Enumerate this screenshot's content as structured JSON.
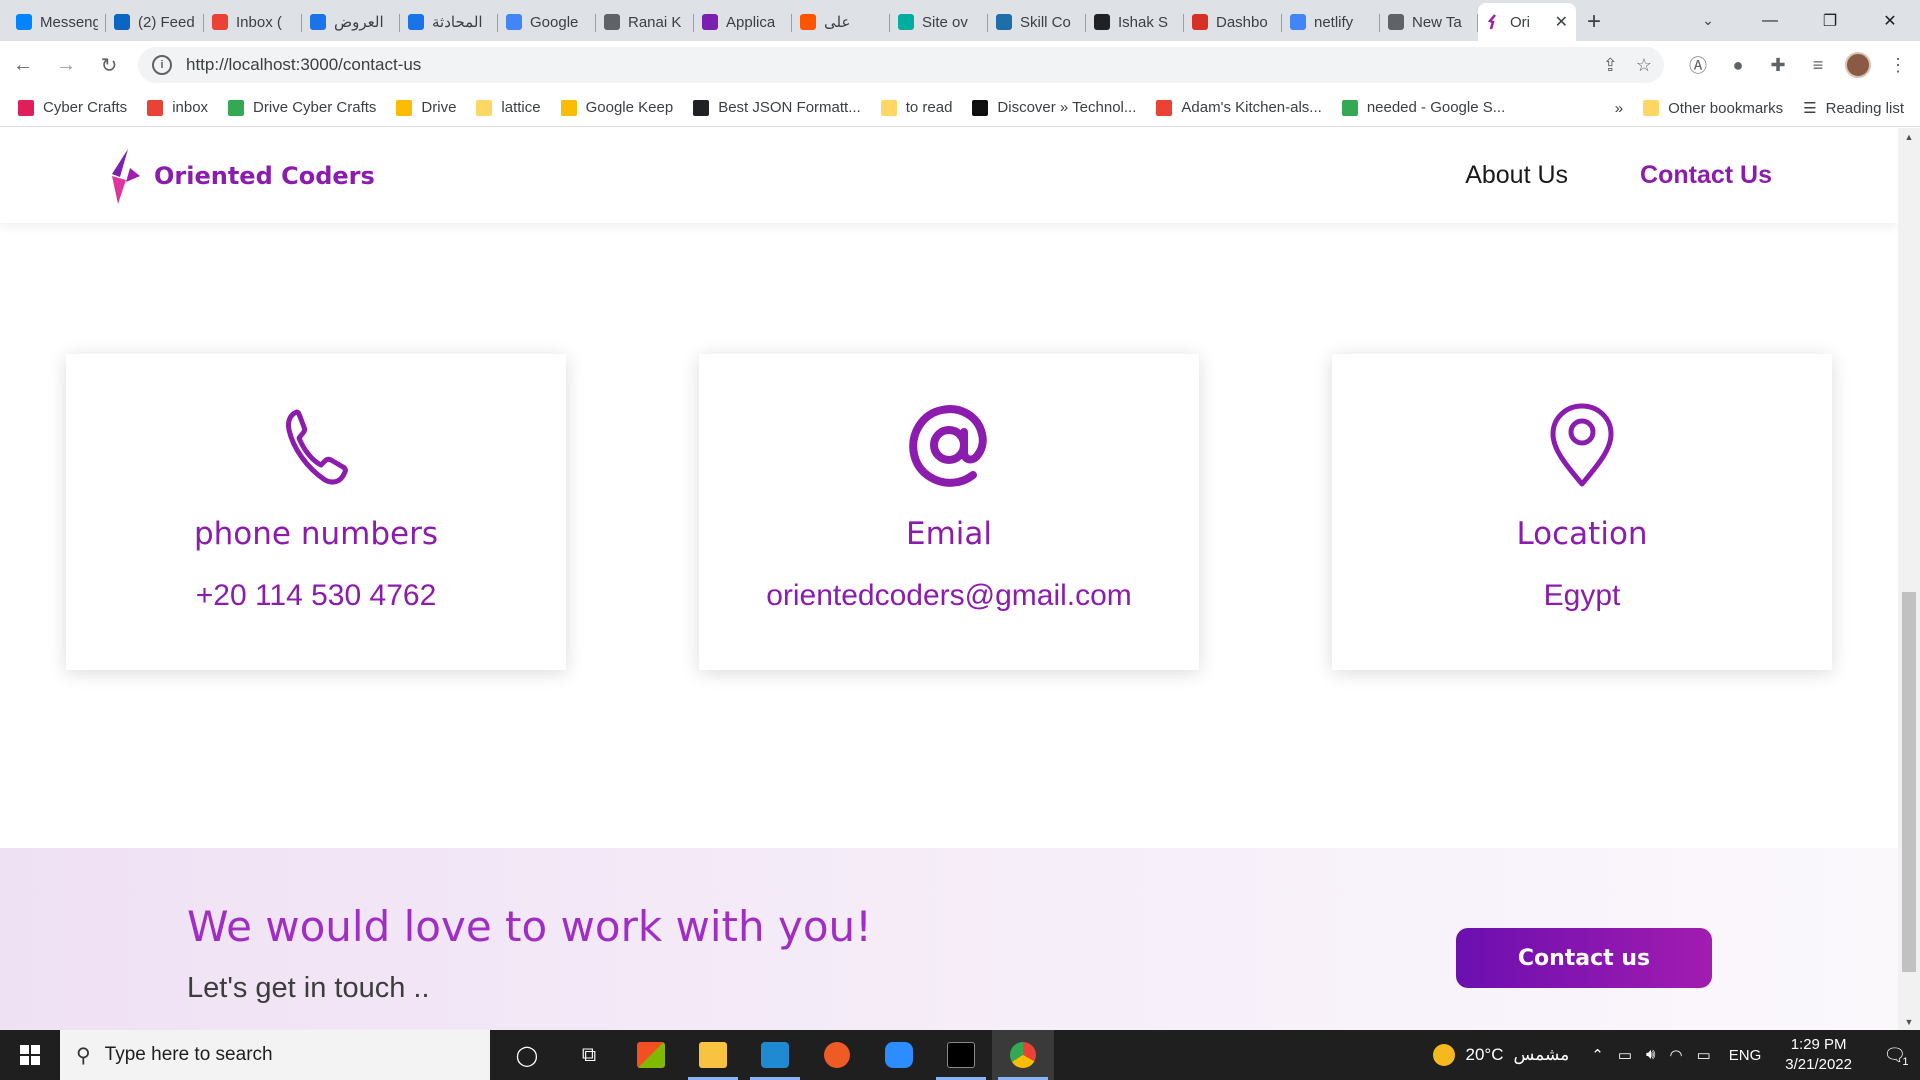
{
  "browser": {
    "tabs": [
      {
        "label": "Messenger",
        "color": "#0084ff"
      },
      {
        "label": "(2) Feed",
        "color": "#0a66c2"
      },
      {
        "label": "Inbox (",
        "color": "#ea4335"
      },
      {
        "label": "العروض",
        "color": "#1a73e8"
      },
      {
        "label": "المحادثة",
        "color": "#1a73e8"
      },
      {
        "label": "Google",
        "color": "#4285f4"
      },
      {
        "label": "Ranai K",
        "color": "#5f6368"
      },
      {
        "label": "Applica",
        "color": "#7a1fb0"
      },
      {
        "label": "على",
        "color": "#ff5500"
      },
      {
        "label": "Site ov",
        "color": "#00ad9f"
      },
      {
        "label": "Skill Co",
        "color": "#1e6ea7"
      },
      {
        "label": "Ishak S",
        "color": "#202124"
      },
      {
        "label": "Dashbo",
        "color": "#d93025"
      },
      {
        "label": "netlify",
        "color": "#4285f4"
      },
      {
        "label": "New Ta",
        "color": "#5f6368"
      }
    ],
    "active_tab": {
      "label": "Ori",
      "color": "#a21cb0"
    },
    "url": "http://localhost:3000/contact-us",
    "bookmarks": [
      {
        "label": "Cyber Crafts",
        "color": "#e01e5a"
      },
      {
        "label": "inbox",
        "color": "#ea4335"
      },
      {
        "label": "Drive Cyber Crafts",
        "color": "#34a853"
      },
      {
        "label": "Drive",
        "color": "#fbbc04"
      },
      {
        "label": "lattice",
        "color": "#fdd663"
      },
      {
        "label": "Google Keep",
        "color": "#fbbc04"
      },
      {
        "label": "Best JSON Formatt...",
        "color": "#202124"
      },
      {
        "label": "to read",
        "color": "#fdd663"
      },
      {
        "label": "Discover » Technol...",
        "color": "#111111"
      },
      {
        "label": "Adam's Kitchen-als...",
        "color": "#ea4335"
      },
      {
        "label": "needed - Google S...",
        "color": "#34a853"
      }
    ],
    "bookmarks_overflow": "»",
    "other_bookmarks": "Other bookmarks",
    "reading_list": "Reading list"
  },
  "site": {
    "brand": "Oriented Coders",
    "nav": {
      "about": "About Us",
      "contact": "Contact Us"
    },
    "cards": [
      {
        "icon": "phone-icon",
        "title": "phone numbers",
        "value": "+20 114 530 4762"
      },
      {
        "icon": "at-sign-icon",
        "title": "Emial",
        "value": "orientedcoders@gmail.com"
      },
      {
        "icon": "location-pin-icon",
        "title": "Location",
        "value": "Egypt"
      }
    ],
    "cta": {
      "headline": "We would love to work with you!",
      "sub": "Let's get in touch ..",
      "button": "Contact us"
    },
    "accent": "#8b1cae"
  },
  "taskbar": {
    "search_placeholder": "Type here to search",
    "weather": "20°C",
    "weather_text": "مشمس",
    "lang": "ENG",
    "time": "1:29 PM",
    "date": "3/21/2022",
    "notif_count": "1"
  }
}
